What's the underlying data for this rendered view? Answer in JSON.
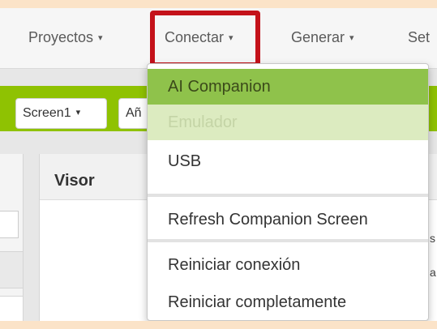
{
  "colors": {
    "frame_background": "#fbe3c8",
    "toolbar_green": "#8fc202",
    "selected_item_green": "#8fc24b",
    "disabled_item_green": "#dcebc0",
    "highlight_red": "#c4121a"
  },
  "topnav": {
    "items": [
      {
        "label": "Proyectos",
        "caret": "▾"
      },
      {
        "label": "Conectar",
        "caret": "▾"
      },
      {
        "label": "Generar",
        "caret": "▾"
      },
      {
        "label": "Set"
      }
    ]
  },
  "toolbar": {
    "screen_button": "Screen1",
    "screen_caret": "▾",
    "add_button": "Añ"
  },
  "visor": {
    "title": "Visor",
    "peek_right_1": "s",
    "peek_right_2": "a"
  },
  "dropdown": {
    "items": [
      {
        "label": "AI Companion",
        "state": "hover"
      },
      {
        "label": "Emulador",
        "state": "disabled"
      },
      {
        "label": "USB",
        "state": "normal"
      },
      {
        "label": "Refresh Companion Screen",
        "state": "normal"
      },
      {
        "label": "Reiniciar conexión",
        "state": "normal"
      },
      {
        "label": "Reiniciar completamente",
        "state": "normal"
      }
    ]
  }
}
